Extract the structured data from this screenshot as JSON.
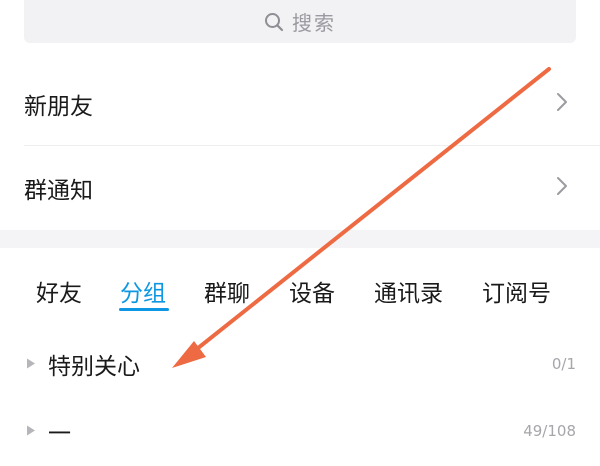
{
  "search": {
    "placeholder": "搜索",
    "icon": "search-icon"
  },
  "menu": {
    "new_friends": "新朋友",
    "group_notice": "群通知"
  },
  "tabs": [
    {
      "label": "好友",
      "active": false
    },
    {
      "label": "分组",
      "active": true
    },
    {
      "label": "群聊",
      "active": false
    },
    {
      "label": "设备",
      "active": false
    },
    {
      "label": "通讯录",
      "active": false
    },
    {
      "label": "订阅号",
      "active": false
    }
  ],
  "groups": [
    {
      "name": "特别关心",
      "count": "0/1"
    },
    {
      "name": "一",
      "count": "49/108"
    }
  ],
  "colors": {
    "accent": "#0d97e2",
    "annotation_arrow": "#ee6a42"
  }
}
